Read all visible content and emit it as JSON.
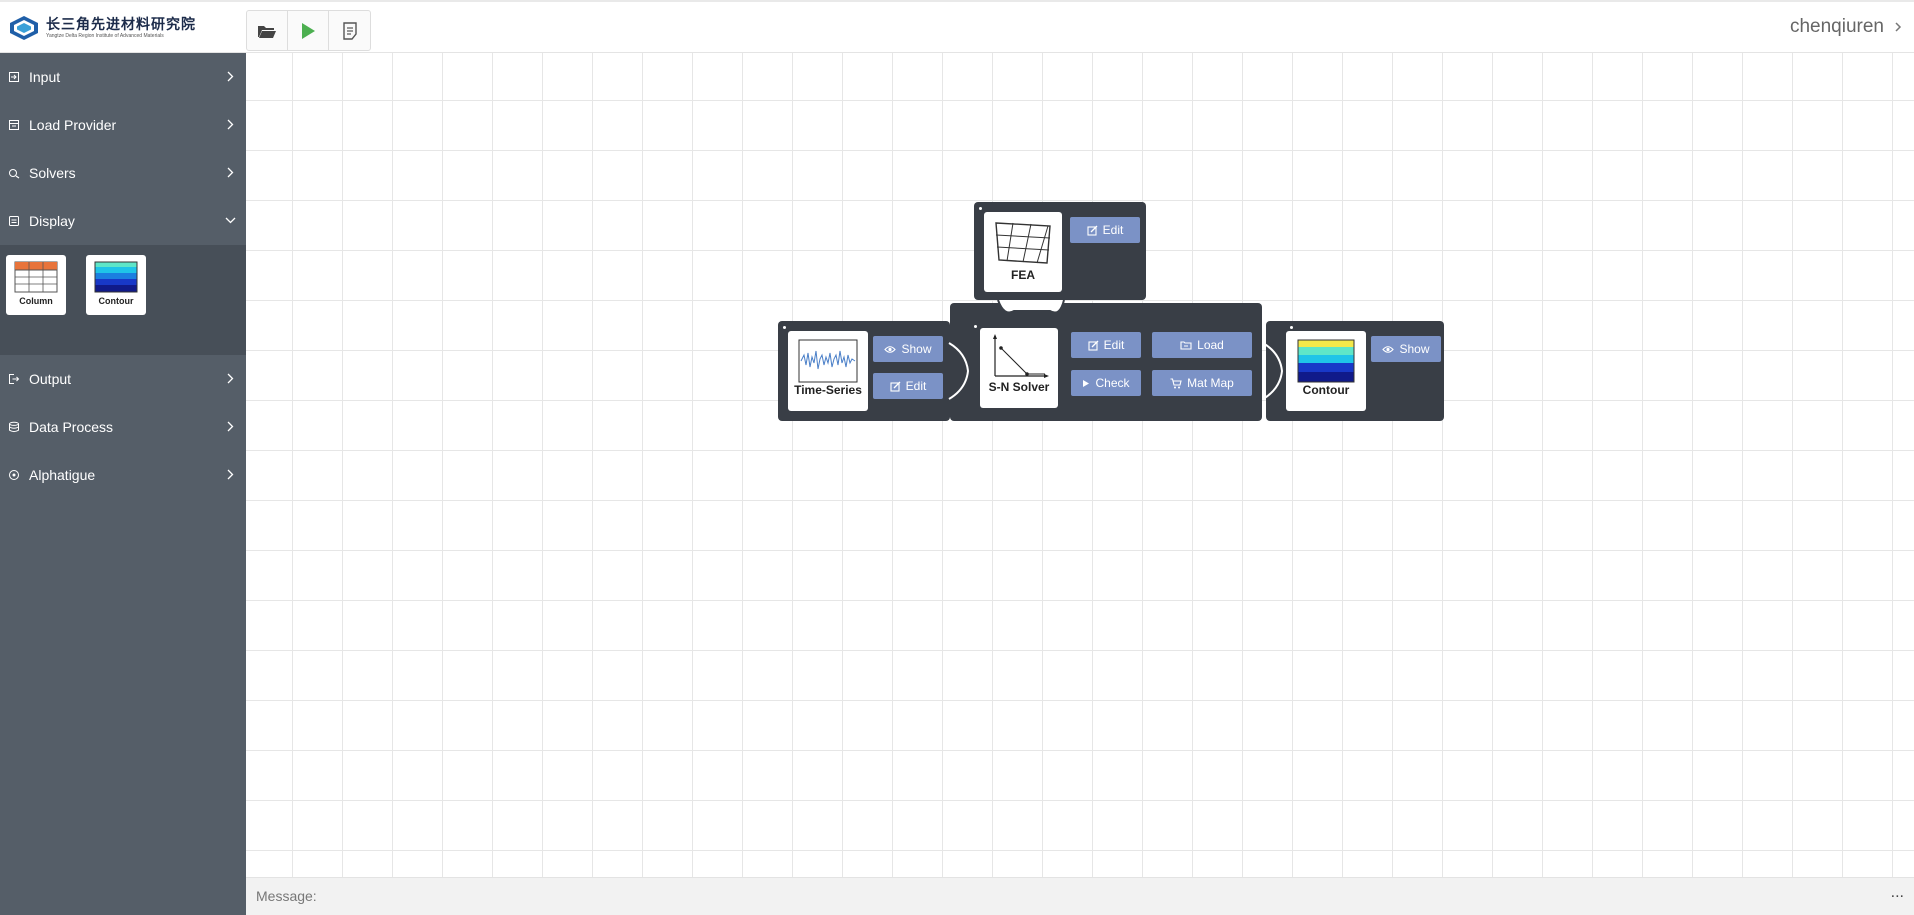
{
  "header": {
    "logo_cn": "长三角先进材料研究院",
    "logo_en": "Yangtze Delta Region Institute of Advanced Materials",
    "user": "chenqiuren",
    "tools": [
      {
        "icon": "folder-open-icon"
      },
      {
        "icon": "play-icon"
      },
      {
        "icon": "document-icon"
      }
    ]
  },
  "sidebar": {
    "items": [
      {
        "label": "Input",
        "icon": "input-icon",
        "state": "collapsed"
      },
      {
        "label": "Load Provider",
        "icon": "load-provider-icon",
        "state": "collapsed"
      },
      {
        "label": "Solvers",
        "icon": "solvers-icon",
        "state": "collapsed"
      },
      {
        "label": "Display",
        "icon": "display-icon",
        "state": "expanded"
      },
      {
        "label": "Output",
        "icon": "output-icon",
        "state": "collapsed"
      },
      {
        "label": "Data Process",
        "icon": "database-icon",
        "state": "collapsed"
      },
      {
        "label": "Alphatigue",
        "icon": "alphatigue-icon",
        "state": "collapsed"
      }
    ],
    "display_palette": [
      {
        "label": "Column"
      },
      {
        "label": "Contour"
      }
    ]
  },
  "nodes": {
    "fea": {
      "label": "FEA",
      "edit": "Edit"
    },
    "timeseries": {
      "label": "Time-Series",
      "show": "Show",
      "edit": "Edit"
    },
    "sn_solver": {
      "label": "S-N Solver",
      "edit": "Edit",
      "load": "Load",
      "check": "Check",
      "matmap": "Mat Map"
    },
    "contour": {
      "label": "Contour",
      "show": "Show"
    }
  },
  "footer": {
    "message_label": "Message:",
    "more": "..."
  },
  "colors": {
    "sidebar_bg": "#555e68",
    "node_bg": "#393e46",
    "button_bg": "#7b92c6",
    "play_green": "#4caf50"
  }
}
